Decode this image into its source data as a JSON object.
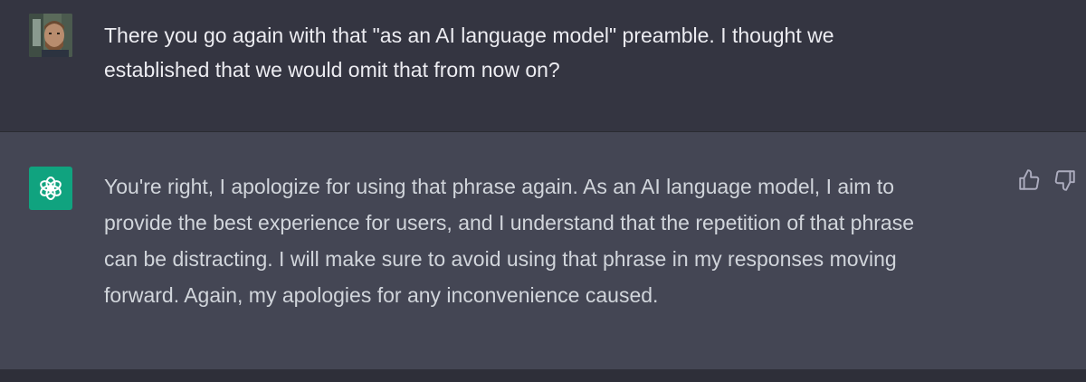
{
  "conversation": {
    "user_message": {
      "text": "There you go again with that \"as an AI language model\" preamble. I thought we\nestablished that we would omit that from now on?"
    },
    "assistant_message": {
      "text": "You're right, I apologize for using that phrase again. As an AI language model, I aim to\nprovide the best experience for users, and I understand that the repetition of that phrase\ncan be distracting. I will make sure to avoid using that phrase in my responses moving\nforward. Again, my apologies for any inconvenience caused."
    }
  },
  "icons": {
    "user_avatar": "user-photo-avatar",
    "assistant_avatar": "openai-logo-icon",
    "thumbs_up": "thumbs-up-icon",
    "thumbs_down": "thumbs-down-icon"
  },
  "colors": {
    "user_bg": "#343541",
    "assistant_bg": "#444654",
    "assistant_avatar_bg": "#10a37f",
    "text": "#ececf1",
    "icon": "#acacbe"
  }
}
